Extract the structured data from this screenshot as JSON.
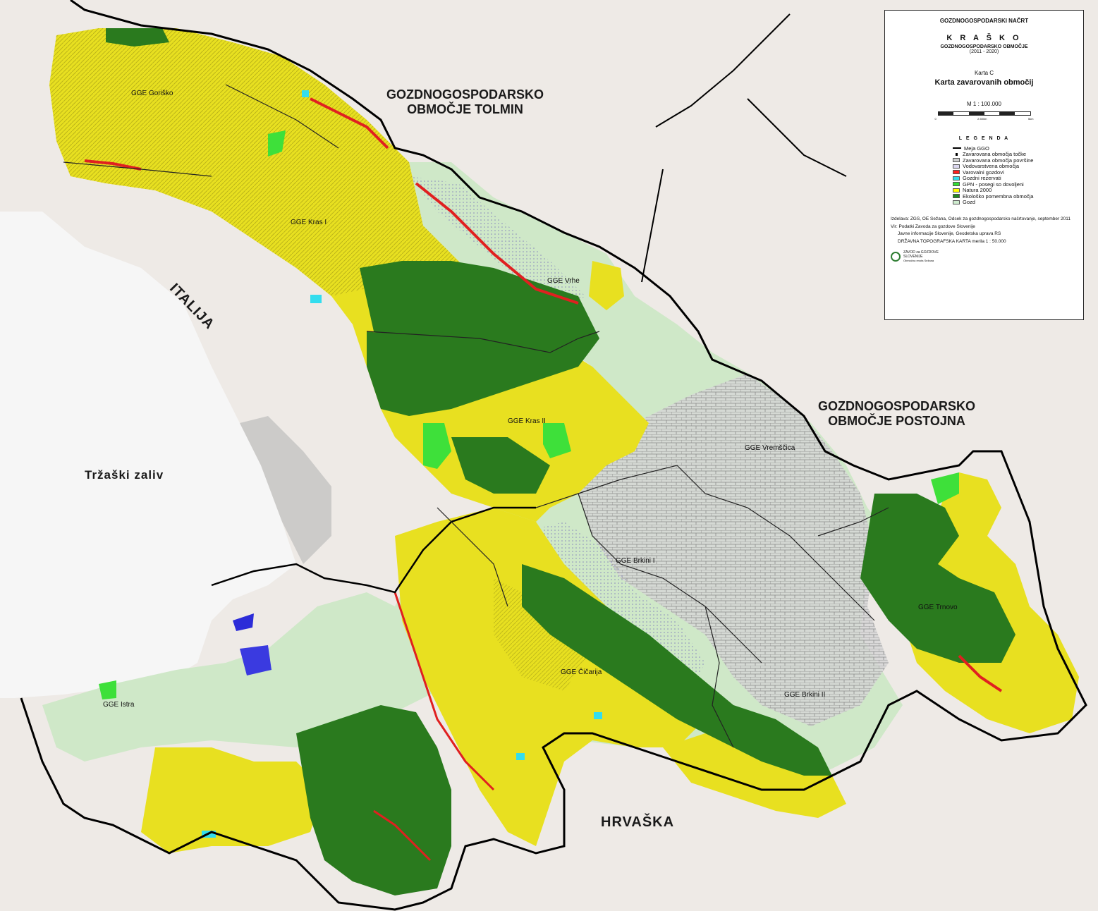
{
  "title_block": {
    "plan": "GOZDNOGOSPODARSKI NAČRT",
    "region": "K R A Š K O",
    "area_type": "GOZDNOGOSPODARSKO OBMOČJE",
    "period": "(2011 - 2020)",
    "map_no": "Karta C",
    "map_title": "Karta zavarovanih območij",
    "scale": "M 1 : 100.000",
    "scale_ticks": [
      "0",
      "2.500m",
      "5km"
    ]
  },
  "legend": {
    "heading": "L E G E N D A",
    "items": [
      {
        "label": "Meja GGO",
        "kind": "line",
        "color": "#000000"
      },
      {
        "label": "Zavarovana območja točke",
        "kind": "tick",
        "color": "#000000"
      },
      {
        "label": "Zavarovana območja površine",
        "kind": "fill",
        "color": "#cfcfcf"
      },
      {
        "label": "Vodovarstvena območja",
        "kind": "fill",
        "color": "#dcd8f0"
      },
      {
        "label": "Varovalni gozdovi",
        "kind": "fill",
        "color": "#ff2020"
      },
      {
        "label": "Gozdni rezervati",
        "kind": "fill",
        "color": "#33ddee"
      },
      {
        "label": "GPN - posegi so dovoljeni",
        "kind": "fill",
        "color": "#33dd33"
      },
      {
        "label": "Natura 2000",
        "kind": "fill",
        "color": "#ffff00"
      },
      {
        "label": "Ekološko pomembna območja",
        "kind": "fill",
        "color": "#228822"
      },
      {
        "label": "Gozd",
        "kind": "fill",
        "color": "#cfeccf"
      }
    ]
  },
  "credits": {
    "made_by": "Izdelava: ZGS, OE Sežana, Odsek za gozdnogospodarsko načrtovanje, september 2011",
    "sources": [
      "Vir: Podatki Zavoda za gozdove Slovenije",
      "Javne informacije Slovenije, Geodetska uprava RS",
      "DRŽAVNA TOPOGRAFSKA KARTA merila 1 : 50.000"
    ],
    "logo_line1": "ZAVOD za GOZDOVE",
    "logo_line2": "SLOVENIJE",
    "logo_line3": "Območna enota Sežana"
  },
  "regions": {
    "tolmin": [
      "GOZDNOGOSPODARSKO",
      "OBMOČJE TOLMIN"
    ],
    "postojna": [
      "GOZDNOGOSPODARSKO",
      "OBMOČJE POSTOJNA"
    ]
  },
  "countries": {
    "italy": "ITALIJA",
    "croatia": "HRVAŠKA"
  },
  "water": {
    "gulf": "Tržaški zaliv"
  },
  "ggu": {
    "gorisko": "GGE Goriško",
    "kras1": "GGE Kras I",
    "vrhe": "GGE Vrhe",
    "kras2": "GGE Kras II",
    "vremscica": "GGE Vremščica",
    "brkini1": "GGE Brkini I",
    "brkini2": "GGE Brkini II",
    "cicarija": "GGE Čičarija",
    "istra": "GGE Istra",
    "trnovo": "GGE Trnovo"
  },
  "colors": {
    "natura": "#e8e020",
    "eco": "#2a7a1e",
    "gozd": "#cfe8c8",
    "gpn": "#3ee03a",
    "protect": "#e02020",
    "reserve": "#33ddee",
    "water_protect": "#dcd8f0",
    "sea": "#f4f4f4",
    "urban": "#9a9a9a",
    "background": "#eeeae6"
  }
}
